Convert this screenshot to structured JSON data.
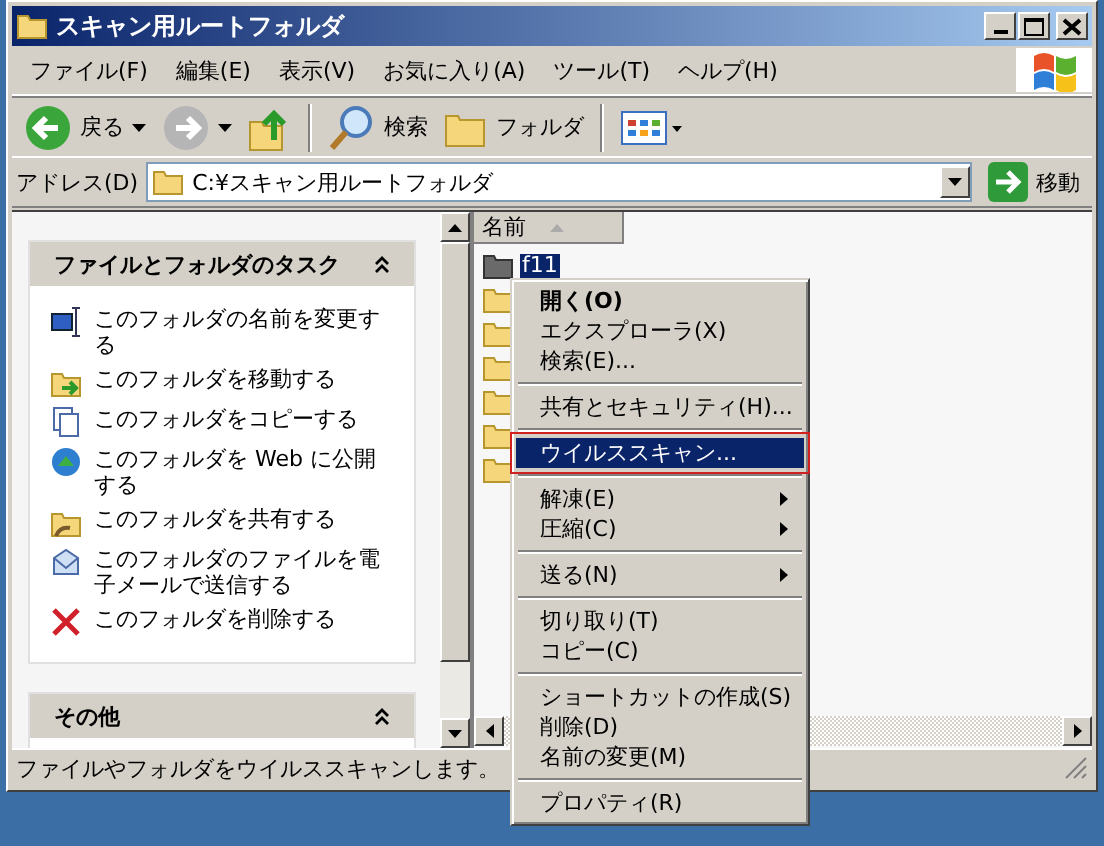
{
  "window": {
    "title": "スキャン用ルートフォルダ"
  },
  "menu": [
    "ファイル(F)",
    "編集(E)",
    "表示(V)",
    "お気に入り(A)",
    "ツール(T)",
    "ヘルプ(H)"
  ],
  "toolbar": [
    {
      "kind": "back",
      "label": "戻る"
    },
    {
      "kind": "forward"
    },
    {
      "kind": "up"
    },
    {
      "kind": "search",
      "label": "検索"
    },
    {
      "kind": "folders",
      "label": "フォルダ"
    },
    {
      "kind": "views"
    }
  ],
  "address": {
    "label": "アドレス(D)",
    "value": "C:¥スキャン用ルートフォルダ",
    "go": "移動"
  },
  "tasks": {
    "title": "ファイルとフォルダのタスク",
    "expanded": true,
    "items": [
      {
        "kind": "rename",
        "label": "このフォルダの名前を変更する"
      },
      {
        "kind": "move",
        "label": "このフォルダを移動する"
      },
      {
        "kind": "copy",
        "label": "このフォルダをコピーする"
      },
      {
        "kind": "web",
        "label": "このフォルダを Web に公開する"
      },
      {
        "kind": "share",
        "label": "このフォルダを共有する"
      },
      {
        "kind": "mail",
        "label": "このフォルダのファイルを電子メールで送信する"
      },
      {
        "kind": "delete",
        "label": "このフォルダを削除する"
      }
    ]
  },
  "other": {
    "title": "その他",
    "expanded": true
  },
  "file_list": {
    "column": "名前",
    "items": [
      {
        "name": "f11",
        "selected": true
      },
      {
        "selected": false
      },
      {
        "selected": false
      },
      {
        "selected": false
      },
      {
        "selected": false
      },
      {
        "selected": false
      },
      {
        "selected": false
      }
    ]
  },
  "context_menu": [
    {
      "kind": "item",
      "label": "開く(O)",
      "bold": true,
      "submenu": false,
      "selected": false
    },
    {
      "kind": "item",
      "label": "エクスプローラ(X)",
      "bold": false,
      "submenu": false,
      "selected": false
    },
    {
      "kind": "item",
      "label": "検索(E)...",
      "bold": false,
      "submenu": false,
      "selected": false
    },
    {
      "kind": "separator"
    },
    {
      "kind": "item",
      "label": "共有とセキュリティ(H)...",
      "bold": false,
      "submenu": false,
      "selected": false
    },
    {
      "kind": "separator"
    },
    {
      "kind": "item",
      "label": "ウイルススキャン...",
      "bold": false,
      "submenu": false,
      "selected": true
    },
    {
      "kind": "separator"
    },
    {
      "kind": "item",
      "label": "解凍(E)",
      "bold": false,
      "submenu": true,
      "selected": false
    },
    {
      "kind": "item",
      "label": "圧縮(C)",
      "bold": false,
      "submenu": true,
      "selected": false
    },
    {
      "kind": "separator"
    },
    {
      "kind": "item",
      "label": "送る(N)",
      "bold": false,
      "submenu": true,
      "selected": false
    },
    {
      "kind": "separator"
    },
    {
      "kind": "item",
      "label": "切り取り(T)",
      "bold": false,
      "submenu": false,
      "selected": false
    },
    {
      "kind": "item",
      "label": "コピー(C)",
      "bold": false,
      "submenu": false,
      "selected": false
    },
    {
      "kind": "separator"
    },
    {
      "kind": "item",
      "label": "ショートカットの作成(S)",
      "bold": false,
      "submenu": false,
      "selected": false
    },
    {
      "kind": "item",
      "label": "削除(D)",
      "bold": false,
      "submenu": false,
      "selected": false
    },
    {
      "kind": "item",
      "label": "名前の変更(M)",
      "bold": false,
      "submenu": false,
      "selected": false
    },
    {
      "kind": "separator"
    },
    {
      "kind": "item",
      "label": "プロパティ(R)",
      "bold": false,
      "submenu": false,
      "selected": false
    }
  ],
  "status_bar": "ファイルやフォルダをウイルススキャンします。"
}
